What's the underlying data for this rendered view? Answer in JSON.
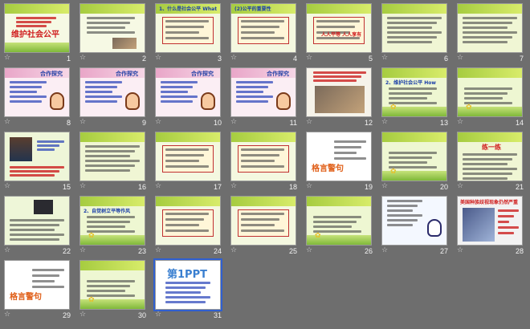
{
  "slides": [
    {
      "number": "1",
      "title": "维护社会公平",
      "style": "title"
    },
    {
      "number": "2",
      "style": "text-photo"
    },
    {
      "number": "3",
      "heading": "1、什么是社会公平 What",
      "style": "text-box"
    },
    {
      "number": "4",
      "heading": "(2)公平的重要性",
      "style": "text-box"
    },
    {
      "number": "5",
      "note": "人人平等 人人享有",
      "style": "text-box-red"
    },
    {
      "number": "6",
      "style": "text-green"
    },
    {
      "number": "7",
      "style": "text-green"
    },
    {
      "number": "8",
      "heading": "合作探究",
      "style": "pink-girl"
    },
    {
      "number": "9",
      "heading": "合作探究",
      "style": "pink-girl"
    },
    {
      "number": "10",
      "heading": "合作探究",
      "style": "pink-girl"
    },
    {
      "number": "11",
      "heading": "合作探究",
      "style": "pink-girl"
    },
    {
      "number": "12",
      "style": "photo"
    },
    {
      "number": "13",
      "heading": "2、维护社会公平 How",
      "style": "green-flower"
    },
    {
      "number": "14",
      "style": "green-flower"
    },
    {
      "number": "15",
      "style": "portrait"
    },
    {
      "number": "16",
      "style": "text-green"
    },
    {
      "number": "17",
      "style": "text-box"
    },
    {
      "number": "18",
      "style": "text-box"
    },
    {
      "number": "19",
      "note": "格言警句",
      "style": "sketch"
    },
    {
      "number": "20",
      "style": "green-flower"
    },
    {
      "number": "21",
      "heading": "练一练",
      "style": "text-green"
    },
    {
      "number": "22",
      "style": "dark-photo"
    },
    {
      "number": "23",
      "heading": "2、自觉树立平等作风",
      "style": "green-flower"
    },
    {
      "number": "24",
      "style": "text-box"
    },
    {
      "number": "25",
      "style": "text-box"
    },
    {
      "number": "26",
      "style": "green-flower"
    },
    {
      "number": "27",
      "style": "snowman"
    },
    {
      "number": "28",
      "heading": "美国种族歧视现象仍然严重",
      "style": "poster"
    },
    {
      "number": "29",
      "note": "格言警句",
      "style": "sketch"
    },
    {
      "number": "30",
      "style": "green-flower"
    },
    {
      "number": "31",
      "logo": "第1PPT",
      "style": "logo"
    }
  ],
  "selected_slide": "31",
  "star_glyph": "☆"
}
